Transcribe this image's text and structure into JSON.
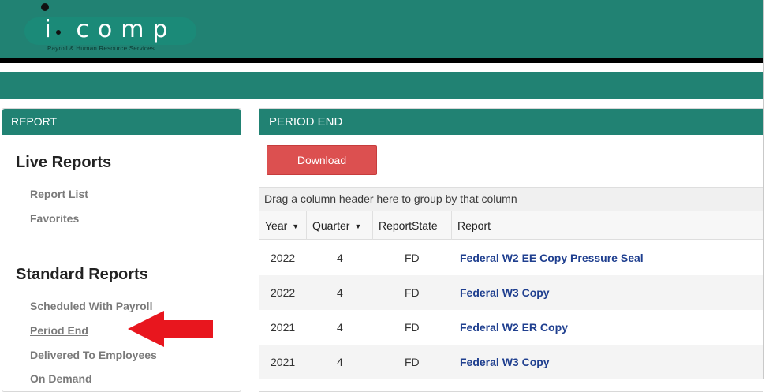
{
  "colors": {
    "header_teal": "#218273",
    "download_red": "#dc5050",
    "link_blue": "#1f3f8f",
    "arrow_red": "#e8161e"
  },
  "logo": {
    "wordmark": "i comp",
    "tagline": "Payroll & Human Resource Services"
  },
  "sidebar": {
    "header": "REPORT",
    "live_title": "Live Reports",
    "live_items": [
      "Report List",
      "Favorites"
    ],
    "standard_title": "Standard Reports",
    "standard_items": [
      "Scheduled With Payroll",
      "Period End",
      "Delivered To Employees",
      "On Demand"
    ],
    "active_item": "Period End"
  },
  "annotation": {
    "icon": "left-arrow-icon"
  },
  "main": {
    "header": "PERIOD END",
    "download_label": "Download",
    "group_hint": "Drag a column header here to group by that column",
    "columns": [
      "Year",
      "Quarter",
      "ReportState",
      "Report"
    ],
    "rows": [
      {
        "year": "2022",
        "quarter": "4",
        "state": "FD",
        "report": "Federal W2 EE Copy Pressure Seal"
      },
      {
        "year": "2022",
        "quarter": "4",
        "state": "FD",
        "report": "Federal W3 Copy"
      },
      {
        "year": "2021",
        "quarter": "4",
        "state": "FD",
        "report": "Federal W2 ER Copy"
      },
      {
        "year": "2021",
        "quarter": "4",
        "state": "FD",
        "report": "Federal W3 Copy"
      }
    ]
  }
}
